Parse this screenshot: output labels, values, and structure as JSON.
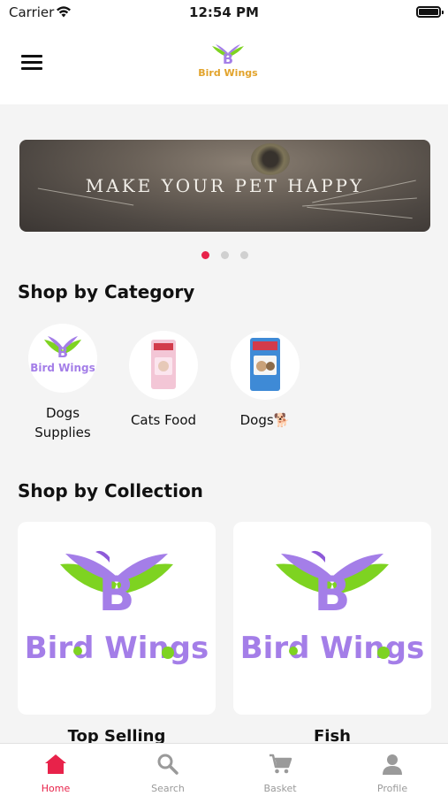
{
  "status_bar": {
    "carrier": "Carrier",
    "time": "12:54 PM"
  },
  "header": {
    "logo_text": "Bird Wings"
  },
  "banner": {
    "text": "MAKE YOUR PET HAPPY",
    "slide_count": 3,
    "active_slide": 1
  },
  "category_section": {
    "title": "Shop by Category",
    "items": [
      {
        "label": "Dogs Supplies",
        "image": "bird-wings-logo"
      },
      {
        "label": "Cats Food",
        "image": "cat-food-bag"
      },
      {
        "label": "Dogs🐕",
        "image": "dog-food-bag"
      }
    ]
  },
  "collection_section": {
    "title": "Shop by Collection",
    "cards": [
      {
        "title": "Top Selling",
        "logo_text": "Bird Wings"
      },
      {
        "title": "Fish",
        "logo_text": "Bird Wings"
      }
    ]
  },
  "bottom_nav": {
    "items": [
      {
        "label": "Home",
        "icon": "home-icon",
        "active": true
      },
      {
        "label": "Search",
        "icon": "search-icon",
        "active": false
      },
      {
        "label": "Basket",
        "icon": "cart-icon",
        "active": false
      },
      {
        "label": "Profile",
        "icon": "person-icon",
        "active": false
      }
    ]
  },
  "colors": {
    "accent": "#e8224a",
    "background": "#f4f4f4",
    "logo_purple": "#a47ee8",
    "logo_green": "#7ed321"
  }
}
